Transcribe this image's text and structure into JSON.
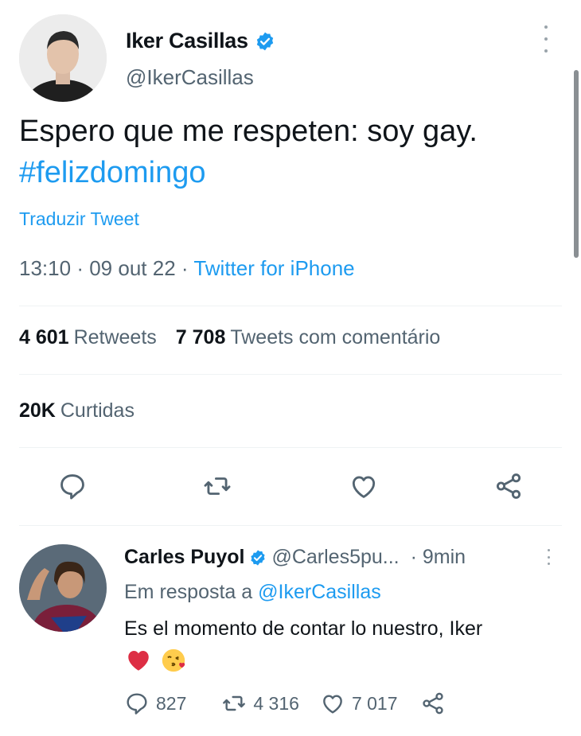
{
  "main_tweet": {
    "author_name": "Iker Casillas",
    "author_handle": "@IkerCasillas",
    "text": "Espero que me respeten: soy gay.",
    "hashtag": "#felizdomingo",
    "translate_label": "Traduzir Tweet",
    "time": "13:10",
    "date": "09 out 22",
    "separator": "·",
    "source": "Twitter for iPhone",
    "retweets_count": "4 601",
    "retweets_label": "Retweets",
    "quotes_count": "7 708",
    "quotes_label": "Tweets com comentário",
    "likes_count": "20K",
    "likes_label": "Curtidas",
    "actions": [
      "reply-icon",
      "retweet-icon",
      "like-icon",
      "share-icon"
    ]
  },
  "reply": {
    "author_name": "Carles Puyol",
    "author_handle": "@Carles5pu...",
    "time": "· 9min",
    "replying_to_prefix": "Em resposta a",
    "replying_to_handle": "@IkerCasillas",
    "text": "Es el momento de contar lo nuestro, Iker",
    "emojis": [
      "❤️",
      "😘"
    ],
    "reply_count": "827",
    "retweet_count": "4 316",
    "like_count": "7 017"
  },
  "colors": {
    "accent": "#1d9bf0",
    "secondary_text": "#536471",
    "primary_text": "#0f1419",
    "divider": "#eff3f4"
  }
}
